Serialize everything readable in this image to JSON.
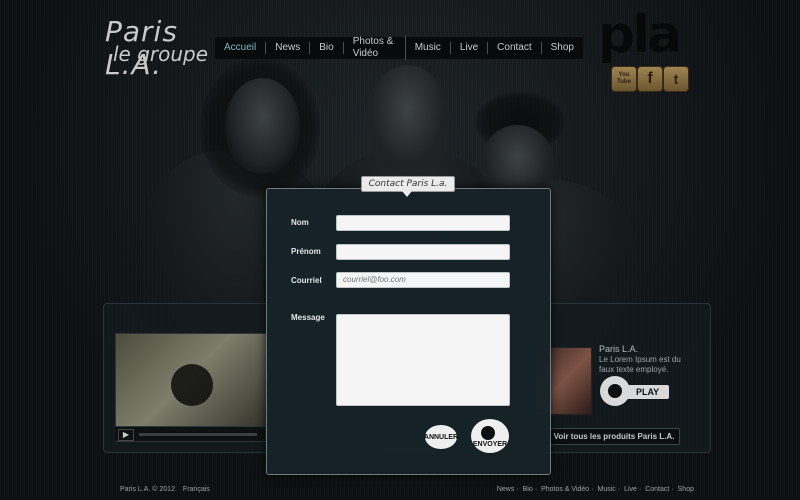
{
  "logo": {
    "line1": "Paris L.A.",
    "line2": "le groupe"
  },
  "nav": {
    "items": [
      {
        "label": "Accueil",
        "active": true
      },
      {
        "label": "News"
      },
      {
        "label": "Bio"
      },
      {
        "label": "Photos & Vidéo"
      },
      {
        "label": "Music"
      },
      {
        "label": "Live"
      },
      {
        "label": "Contact"
      },
      {
        "label": "Shop"
      }
    ]
  },
  "brand_mark": "pla",
  "social": {
    "youtube": "You Tube",
    "facebook": "f",
    "twitter": "t"
  },
  "modal": {
    "title": "Contact Paris L.a.",
    "fields": {
      "nom_label": "Nom",
      "prenom_label": "Prénom",
      "courriel_label": "Courriel",
      "courriel_placeholder": "courriel@foo.com",
      "message_label": "Message"
    },
    "buttons": {
      "cancel": "ANNULER",
      "send": "ENVOYER"
    }
  },
  "product": {
    "title": "Paris L.A.",
    "description": "Le Lorem Ipsum est du faux texte employé.",
    "play_label": "PLAY",
    "all_products": "Voir tous les produits Paris L.A."
  },
  "footer": {
    "copyright": "Paris L.A. © 2012",
    "language": "Français",
    "links": [
      "News",
      "Bio",
      "Photos & Vidéo",
      "Music",
      "Live",
      "Contact",
      "Shop"
    ],
    "separator": "·"
  },
  "colors": {
    "accent": "#7ab6c8",
    "background": "#0d1012",
    "social": "#9e8452"
  }
}
